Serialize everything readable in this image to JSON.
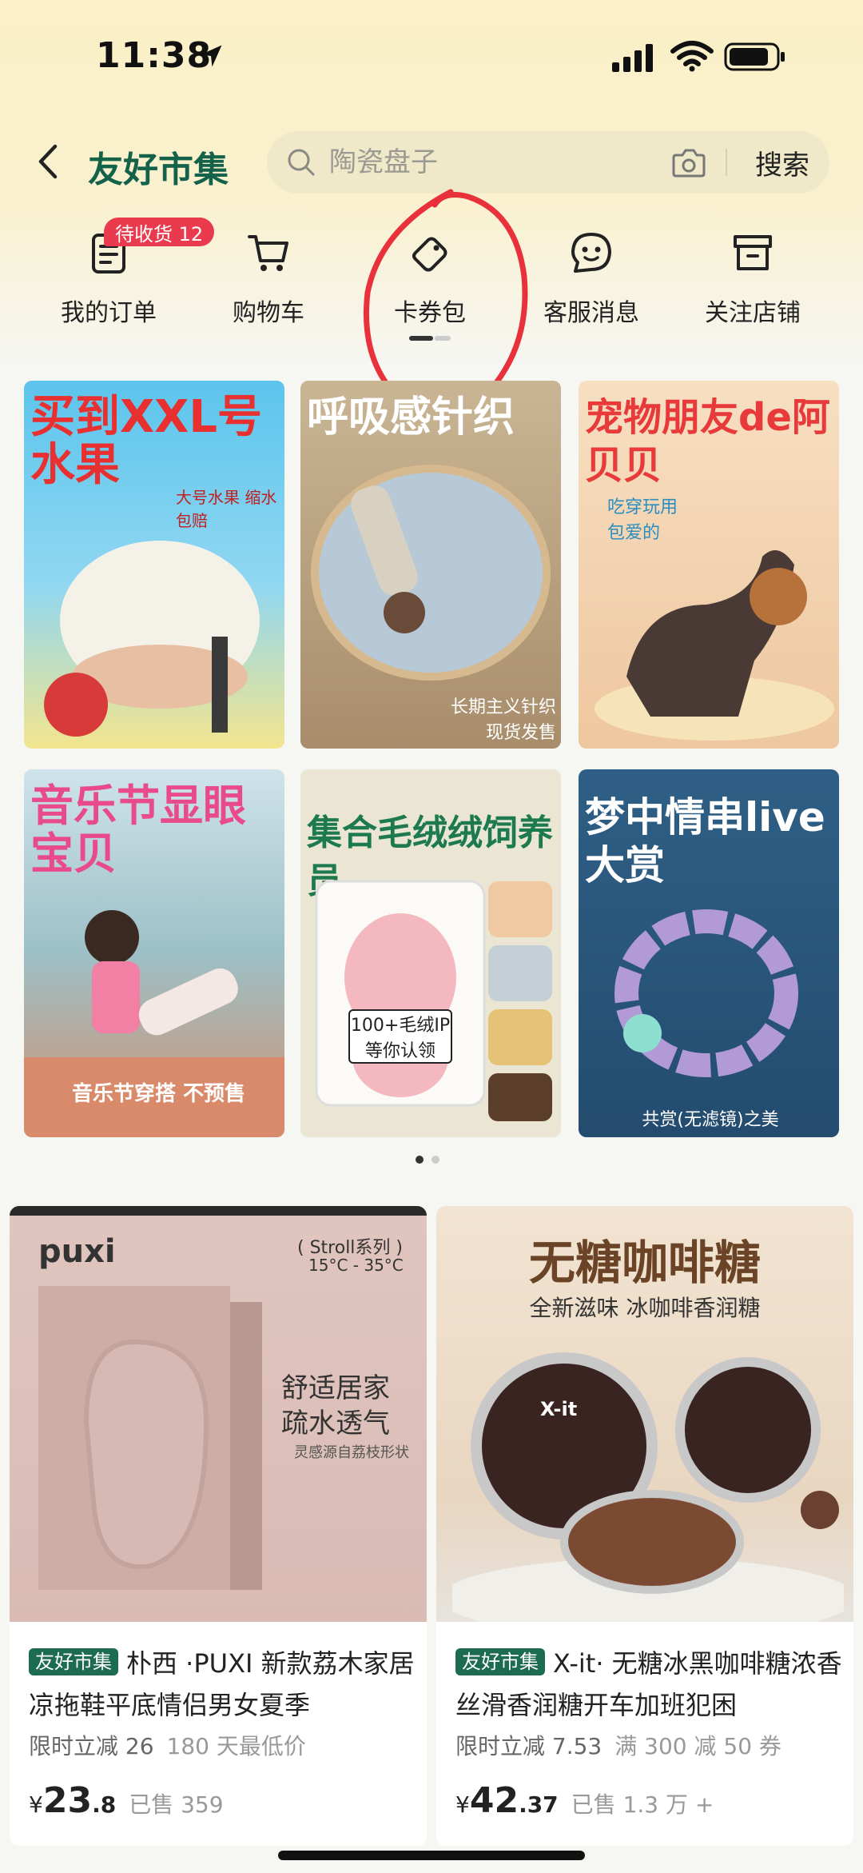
{
  "status_bar": {
    "time": "11:38"
  },
  "header": {
    "back_label": "",
    "title": "友好市集",
    "search": {
      "placeholder": "陶瓷盘子",
      "button": "搜索"
    }
  },
  "quick_nav": {
    "badge": "待收货 12",
    "items": [
      {
        "label": "我的订单",
        "icon": "order-icon"
      },
      {
        "label": "购物车",
        "icon": "cart-icon"
      },
      {
        "label": "卡券包",
        "icon": "coupon-icon"
      },
      {
        "label": "客服消息",
        "icon": "chat-icon"
      },
      {
        "label": "关注店铺",
        "icon": "store-icon"
      }
    ]
  },
  "banners": [
    {
      "title": "买到XXL号水果",
      "sub": "大号水果 缩水包赔"
    },
    {
      "title": "呼吸感针织",
      "sub": "长期主义针织 现货发售"
    },
    {
      "title": "宠物朋友de阿贝贝",
      "sub": "吃穿玩用 包爱的"
    },
    {
      "title": "音乐节显眼宝贝",
      "sub": "音乐节穿搭 不预售"
    },
    {
      "title": "集合毛绒绒饲养员",
      "sub": "100+毛绒IP 等你认领"
    },
    {
      "title": "梦中情串live大赏",
      "sub": "共赏(无滤镜)之美"
    }
  ],
  "products": [
    {
      "shop_tag": "友好市集",
      "title": "朴西 ·PUXI 新款荔木家居凉拖鞋平底情侣男女夏季",
      "promo": "限时立减 26",
      "promo2": "180 天最低价",
      "price_symbol": "¥",
      "price_int": "23",
      "price_dec": ".8",
      "sold": "已售 359",
      "img_brand": "puxi",
      "img_series": "( Stroll系列 )",
      "img_temp": "15°C - 35°C",
      "img_line1": "舒适居家",
      "img_line2": "疏水透气",
      "img_line3": "灵感源自荔枝形状"
    },
    {
      "shop_tag": "友好市集",
      "title": "X-it· 无糖冰黑咖啡糖浓香丝滑香润糖开车加班犯困",
      "promo": "限时立减 7.53",
      "promo2": "满 300 减 50 券",
      "price_symbol": "¥",
      "price_int": "42",
      "price_dec": ".37",
      "sold": "已售 1.3 万 +",
      "img_title": "无糖咖啡糖",
      "img_sub": "全新滋味 冰咖啡香润糖",
      "img_brand": "X-it"
    }
  ],
  "colors": {
    "accent": "#14624a",
    "badge": "#ea3a4d",
    "annotation": "#e8313a"
  }
}
